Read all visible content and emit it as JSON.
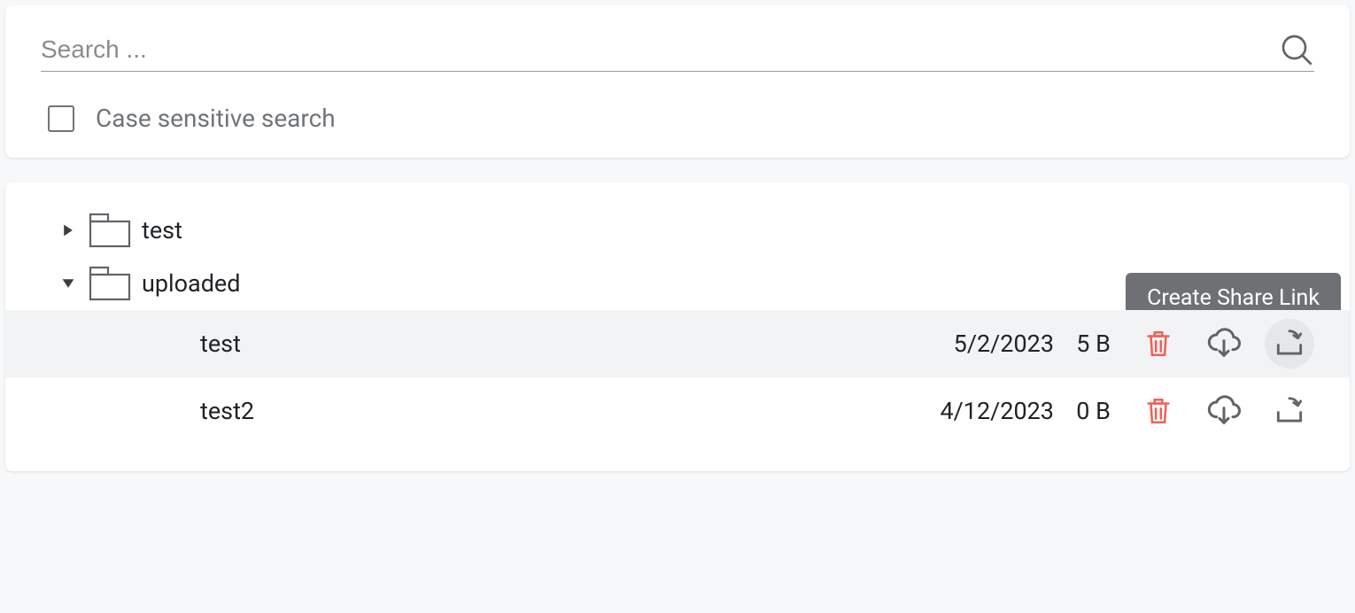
{
  "search": {
    "placeholder": "Search ...",
    "case_sensitive_label": "Case sensitive search"
  },
  "tooltip": {
    "create_share_link": "Create Share Link"
  },
  "tree": {
    "folders": [
      {
        "name": "test",
        "expanded": false
      },
      {
        "name": "uploaded",
        "expanded": true
      }
    ],
    "files": [
      {
        "name": "test",
        "date": "5/2/2023",
        "size": "5 B",
        "hovered": true
      },
      {
        "name": "test2",
        "date": "4/12/2023",
        "size": "0 B",
        "hovered": false
      }
    ]
  }
}
